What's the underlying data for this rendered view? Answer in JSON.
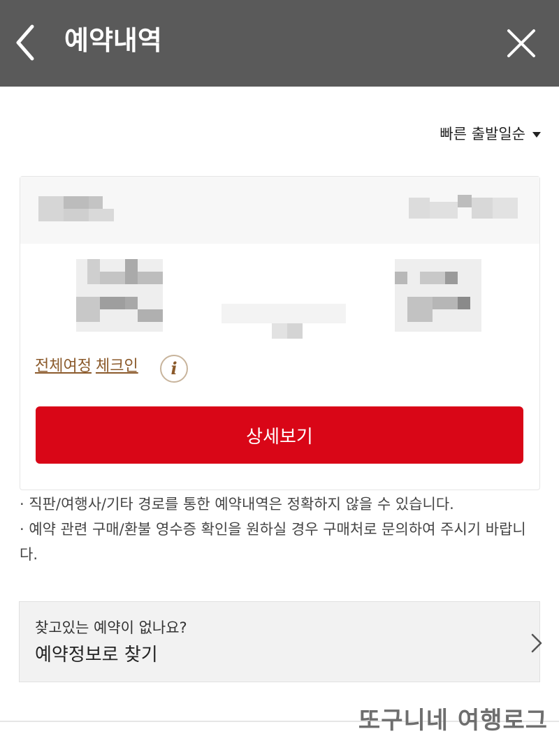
{
  "header": {
    "title": "예약내역",
    "bg_color": "#5a5a5a"
  },
  "sort": {
    "label": "빠른 출발일순"
  },
  "card": {
    "links": {
      "itinerary": "전체여정",
      "checkin": "체크인"
    },
    "info_icon": "i",
    "detail_button": "상세보기",
    "button_color": "#d90617"
  },
  "notice": {
    "line1": "· 직판/여행사/기타 경로를 통한 예약내역은 정확하지 않을 수 있습니다.",
    "line2": "· 예약 관련 구매/환불 영수증 확인을 원하실 경우 구매처로 문의하여 주시기 바랍니다."
  },
  "find": {
    "question": "찾고있는 예약이 없나요?",
    "title": "예약정보로 찾기"
  },
  "watermark": "또구니네 여행로그",
  "icons": {
    "back": "chevron-left-icon",
    "close": "close-icon",
    "sort_caret": "caret-down-icon",
    "info": "info-icon",
    "find_arrow": "chevron-right-icon"
  }
}
